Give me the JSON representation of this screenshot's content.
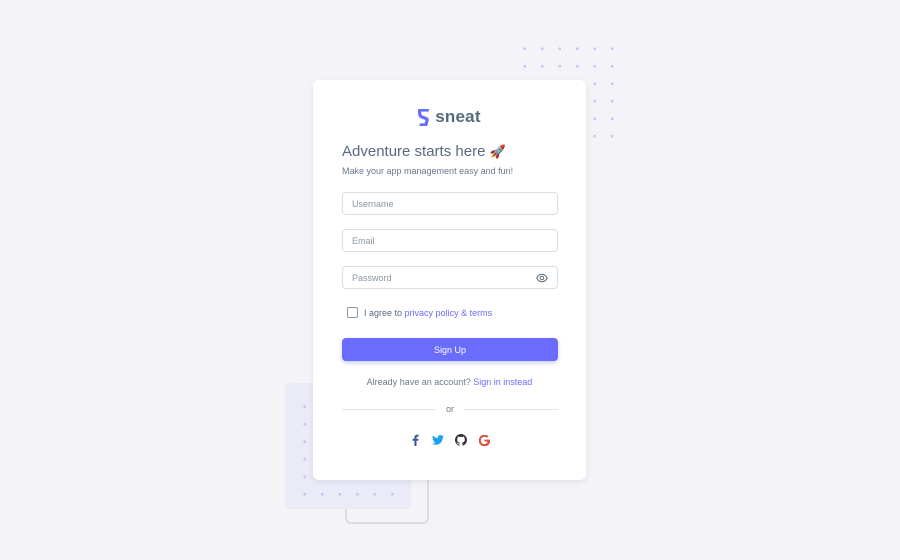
{
  "brand": {
    "name": "sneat",
    "accent": "#696cff"
  },
  "heading": {
    "title": "Adventure starts here",
    "emoji": "🚀",
    "subtitle": "Make your app management easy and fun!"
  },
  "form": {
    "username_placeholder": "Username",
    "email_placeholder": "Email",
    "password_placeholder": "Password",
    "agree_prefix": "I agree to",
    "agree_link": "privacy policy & terms",
    "submit_label": "Sign Up"
  },
  "signin": {
    "prompt": "Already have an account?",
    "link": "Sign in instead"
  },
  "divider_text": "or",
  "socials": [
    {
      "icon": "facebook-icon",
      "color": "#3b5998"
    },
    {
      "icon": "twitter-icon",
      "color": "#1da1f2"
    },
    {
      "icon": "github-icon",
      "color": "#333333"
    },
    {
      "icon": "google-icon",
      "color": "#dd4b39"
    }
  ],
  "colors": {
    "background": "#f4f4f8",
    "card": "#ffffff",
    "text": "#566a7f"
  }
}
